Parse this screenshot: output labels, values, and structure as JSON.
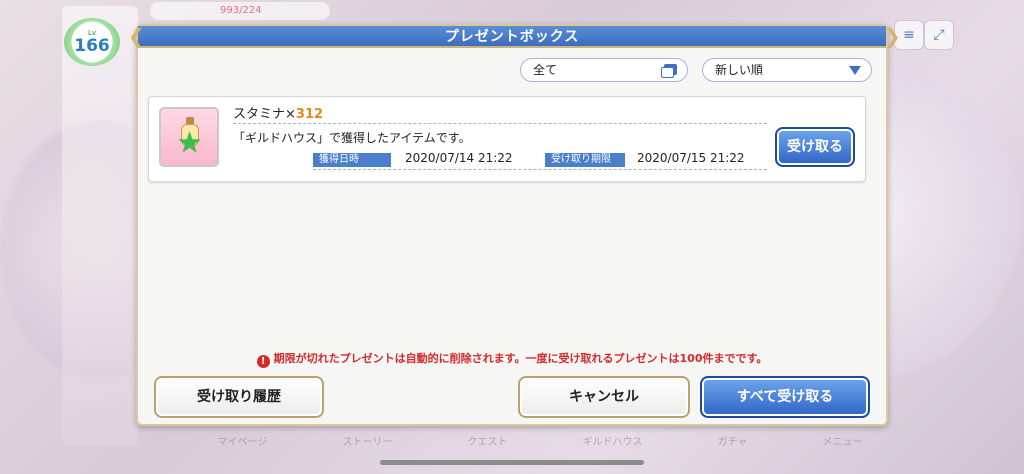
{
  "background": {
    "level_label": "Lv",
    "level": "166",
    "stamina_display": "993/224",
    "nav_items": [
      "マイページ",
      "ストーリー",
      "クエスト",
      "ギルドハウス",
      "ガチャ",
      "メニュー"
    ]
  },
  "dialog": {
    "title": "プレゼントボックス",
    "filter": {
      "selected": "全て"
    },
    "sort": {
      "selected": "新しい順"
    },
    "items": [
      {
        "name": "スタミナ",
        "multiplier": "×",
        "quantity": "312",
        "description": "「ギルドハウス」で獲得したアイテムです。",
        "acquired_label": "獲得日時",
        "acquired_date": "2020/07/14 21:22",
        "deadline_label": "受け取り期限",
        "deadline_date": "2020/07/15 21:22",
        "receive_label": "受け取る",
        "icon": "stamina-potion-icon"
      }
    ],
    "notice": "期限が切れたプレゼントは自動的に削除されます。一度に受け取れるプレゼントは100件までです。",
    "buttons": {
      "history": "受け取り履歴",
      "cancel": "キャンセル",
      "receive_all": "すべて受け取る"
    }
  },
  "colors": {
    "header": "#3c6dbf",
    "accent_blue": "#2f64c6",
    "gold_border": "#d9c99a",
    "notice_red": "#d42a2a",
    "quantity_orange": "#e28a1a"
  }
}
